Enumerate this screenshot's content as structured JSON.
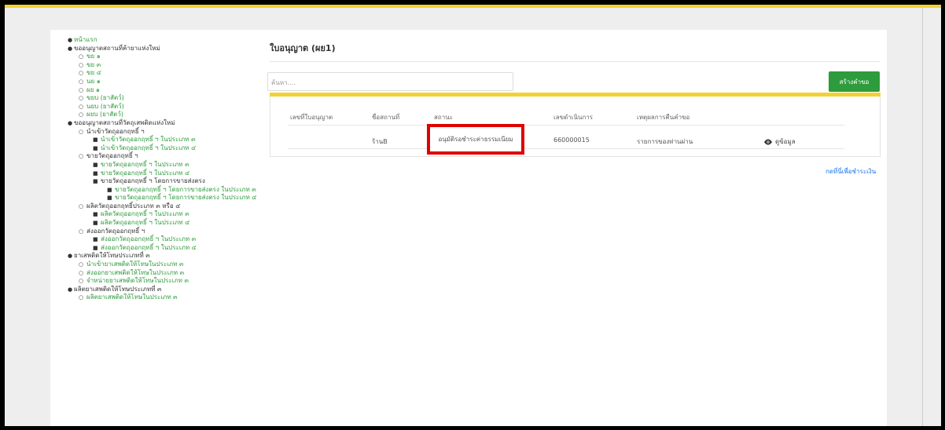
{
  "sidebar": {
    "home": "หน้าแรก",
    "sec1": "ขออนุญาตสถานที่ค้ายาแห่งใหม่",
    "sec1_items": [
      "ขย ๑",
      "ขย ๓",
      "ขย ๔",
      "นย ๑",
      "ผย ๑",
      "ขยบ (ยาสัตว์)",
      "นยบ (ยาสัตว์)",
      "ผยบ (ยาสัตว์)"
    ],
    "sec2": "ขออนุญาตสถานที่วัตถุเสพติดแห่งใหม่",
    "sec2_g1": "นำเข้าวัตถุออกฤทธิ์ ฯ",
    "sec2_g1_items": [
      "นำเข้าวัตถุออกฤทธิ์ ฯ ในประเภท ๓",
      "นำเข้าวัตถุออกฤทธิ์ ฯ ในประเภท ๔"
    ],
    "sec2_g2": "ขายวัตถุออกฤทธิ์ ฯ",
    "sec2_g2_items": [
      "ขายวัตถุออกฤทธิ์ ฯ ในประเภท ๓",
      "ขายวัตถุออกฤทธิ์ ฯ ในประเภท ๔"
    ],
    "sec2_g2_sub": "ขายวัตถุออกฤทธิ์ ฯ โดยการขายส่งตรง",
    "sec2_g2_sub_items": [
      "ขายวัตถุออกฤทธิ์ ฯ โดยการขายส่งตรง ในประเภท ๓",
      "ขายวัตถุออกฤทธิ์ ฯ โดยการขายส่งตรง ในประเภท ๔"
    ],
    "sec2_g3": "ผลิตวัตถุออกฤทธิ์ประเภท ๓ หรือ ๔",
    "sec2_g3_items": [
      "ผลิตวัตถุออกฤทธิ์ ฯ ในประเภท ๓",
      "ผลิตวัตถุออกฤทธิ์ ฯ ในประเภท ๔"
    ],
    "sec2_g4": "ส่งออกวัตถุออกฤทธิ์ ฯ",
    "sec2_g4_items": [
      "ส่งออกวัตถุออกฤทธิ์ ฯ ในประเภท ๓",
      "ส่งออกวัตถุออกฤทธิ์ ฯ ในประเภท ๔"
    ],
    "sec3": "ยาเสพติดให้โทษประเภทที่ ๓",
    "sec3_items": [
      "นำเข้ายาเสพติดให้โทษในประเภท ๓",
      "ส่งออกยาเสพติดให้โทษในประเภท ๓",
      "จำหน่ายยาเสพติดให้โทษในประเภท ๓"
    ],
    "sec4": "ผลิตยาเสพติดให้โทษประเภทที่ ๓",
    "sec4_items": [
      "ผลิตยาเสพติดให้โทษในประเภท ๓"
    ]
  },
  "main": {
    "title": "ใบอนุญาต (ผย1)",
    "search_placeholder": "ค้นหา....",
    "create_button": "สร้างคำขอ",
    "columns": [
      "เลขที่ใบอนุญาต",
      "ชื่อสถานที่",
      "สถานะ",
      "เลขดำเนินการ",
      "เหตุผลการคืนคำขอ"
    ],
    "row": {
      "license_no": "",
      "place_name": "ร้านB",
      "status": "อนุมัติรอชำระค่าธรรมเนียม",
      "process_no": "660000015",
      "reason": "รายการของท่านผ่าน",
      "view": "ดูข้อมูล"
    },
    "pay_link": "กดที่นี่เพื่อชำระเงิน"
  },
  "colors": {
    "accent_green": "#2e9b3c",
    "accent_yellow": "#f2d233",
    "highlight_red": "#e00000"
  }
}
